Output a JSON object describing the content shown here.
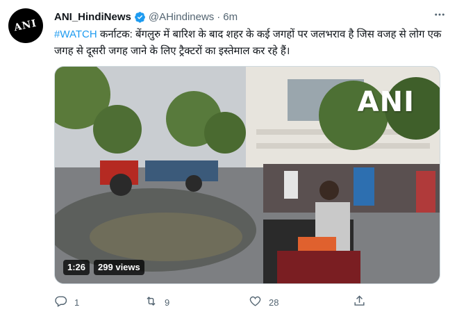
{
  "tweet": {
    "author_name": "ANI_HindiNews",
    "handle": "@AHindinews",
    "separator": "·",
    "time": "6m",
    "avatar_text": "ANI",
    "hashtag": "#WATCH",
    "body_text": " कर्नाटक: बेंगलुरु में बारिश के बाद शहर के कई जगहों पर जलभराव है जिस वजह से लोग एक जगह से दूसरी जगह जाने के लिए ट्रैक्टरों का इस्तेमाल कर रहे हैं।",
    "media": {
      "watermark": "ANI",
      "duration": "1:26",
      "views": "299 views"
    },
    "actions": {
      "replies": "1",
      "retweets": "9",
      "likes": "28"
    }
  },
  "icons": {
    "verified": "verified-badge-icon",
    "more": "more-options-icon",
    "reply": "reply-icon",
    "retweet": "retweet-icon",
    "like": "heart-icon",
    "share": "share-icon"
  },
  "colors": {
    "accent": "#1d9bf0",
    "text": "#0f1419",
    "secondary": "#536471"
  }
}
